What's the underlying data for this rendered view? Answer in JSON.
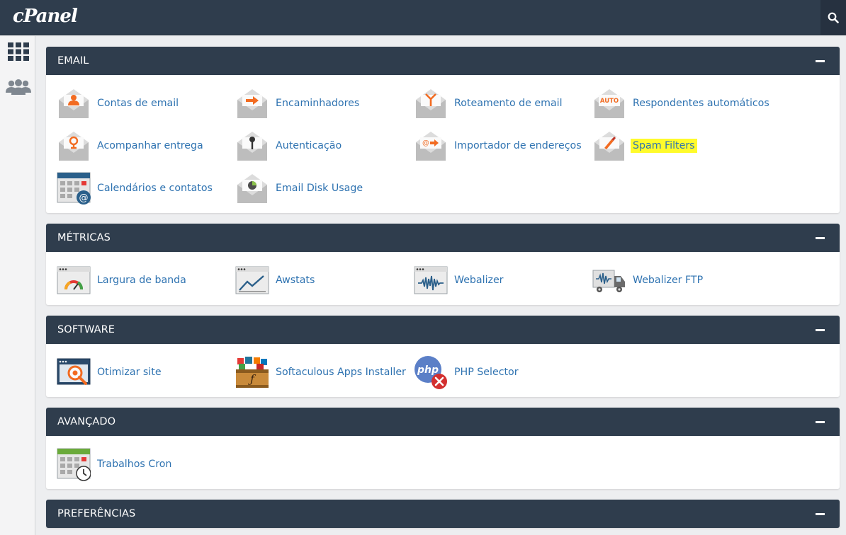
{
  "app": {
    "logo_text": "cPanel"
  },
  "topbar": {
    "search_icon": "search-icon"
  },
  "sidenav": {
    "items": [
      {
        "icon": "grid-icon"
      },
      {
        "icon": "users-icon"
      }
    ]
  },
  "sections": [
    {
      "title": "EMAIL",
      "items": [
        {
          "label": "Contas de email",
          "icon": "email-accounts-icon"
        },
        {
          "label": "Encaminhadores",
          "icon": "forwarders-icon"
        },
        {
          "label": "Roteamento de email",
          "icon": "email-routing-icon"
        },
        {
          "label": "Respondentes automáticos",
          "icon": "autoresponders-icon"
        },
        {
          "label": "Acompanhar entrega",
          "icon": "track-delivery-icon"
        },
        {
          "label": "Autenticação",
          "icon": "authentication-icon"
        },
        {
          "label": "Importador de endereços",
          "icon": "address-importer-icon"
        },
        {
          "label": "Spam Filters",
          "icon": "spam-filters-icon",
          "highlighted": true
        },
        {
          "label": "Calendários e contatos",
          "icon": "calendars-contacts-icon"
        },
        {
          "label": "Email Disk Usage",
          "icon": "email-disk-usage-icon"
        }
      ]
    },
    {
      "title": "MÉTRICAS",
      "items": [
        {
          "label": "Largura de banda",
          "icon": "bandwidth-icon"
        },
        {
          "label": "Awstats",
          "icon": "awstats-icon"
        },
        {
          "label": "Webalizer",
          "icon": "webalizer-icon"
        },
        {
          "label": "Webalizer FTP",
          "icon": "webalizer-ftp-icon"
        }
      ]
    },
    {
      "title": "SOFTWARE",
      "items": [
        {
          "label": "Otimizar site",
          "icon": "optimize-website-icon"
        },
        {
          "label": "Softaculous Apps Installer",
          "icon": "softaculous-icon"
        },
        {
          "label": "PHP Selector",
          "icon": "php-selector-icon"
        }
      ]
    },
    {
      "title": "AVANÇADO",
      "items": [
        {
          "label": "Trabalhos Cron",
          "icon": "cron-jobs-icon"
        }
      ]
    },
    {
      "title": "PREFERÊNCIAS",
      "items": []
    }
  ],
  "colors": {
    "header": "#2f3d4d",
    "link": "#2f73b1",
    "highlight": "#fffb2b",
    "accent_orange": "#f26b21"
  }
}
